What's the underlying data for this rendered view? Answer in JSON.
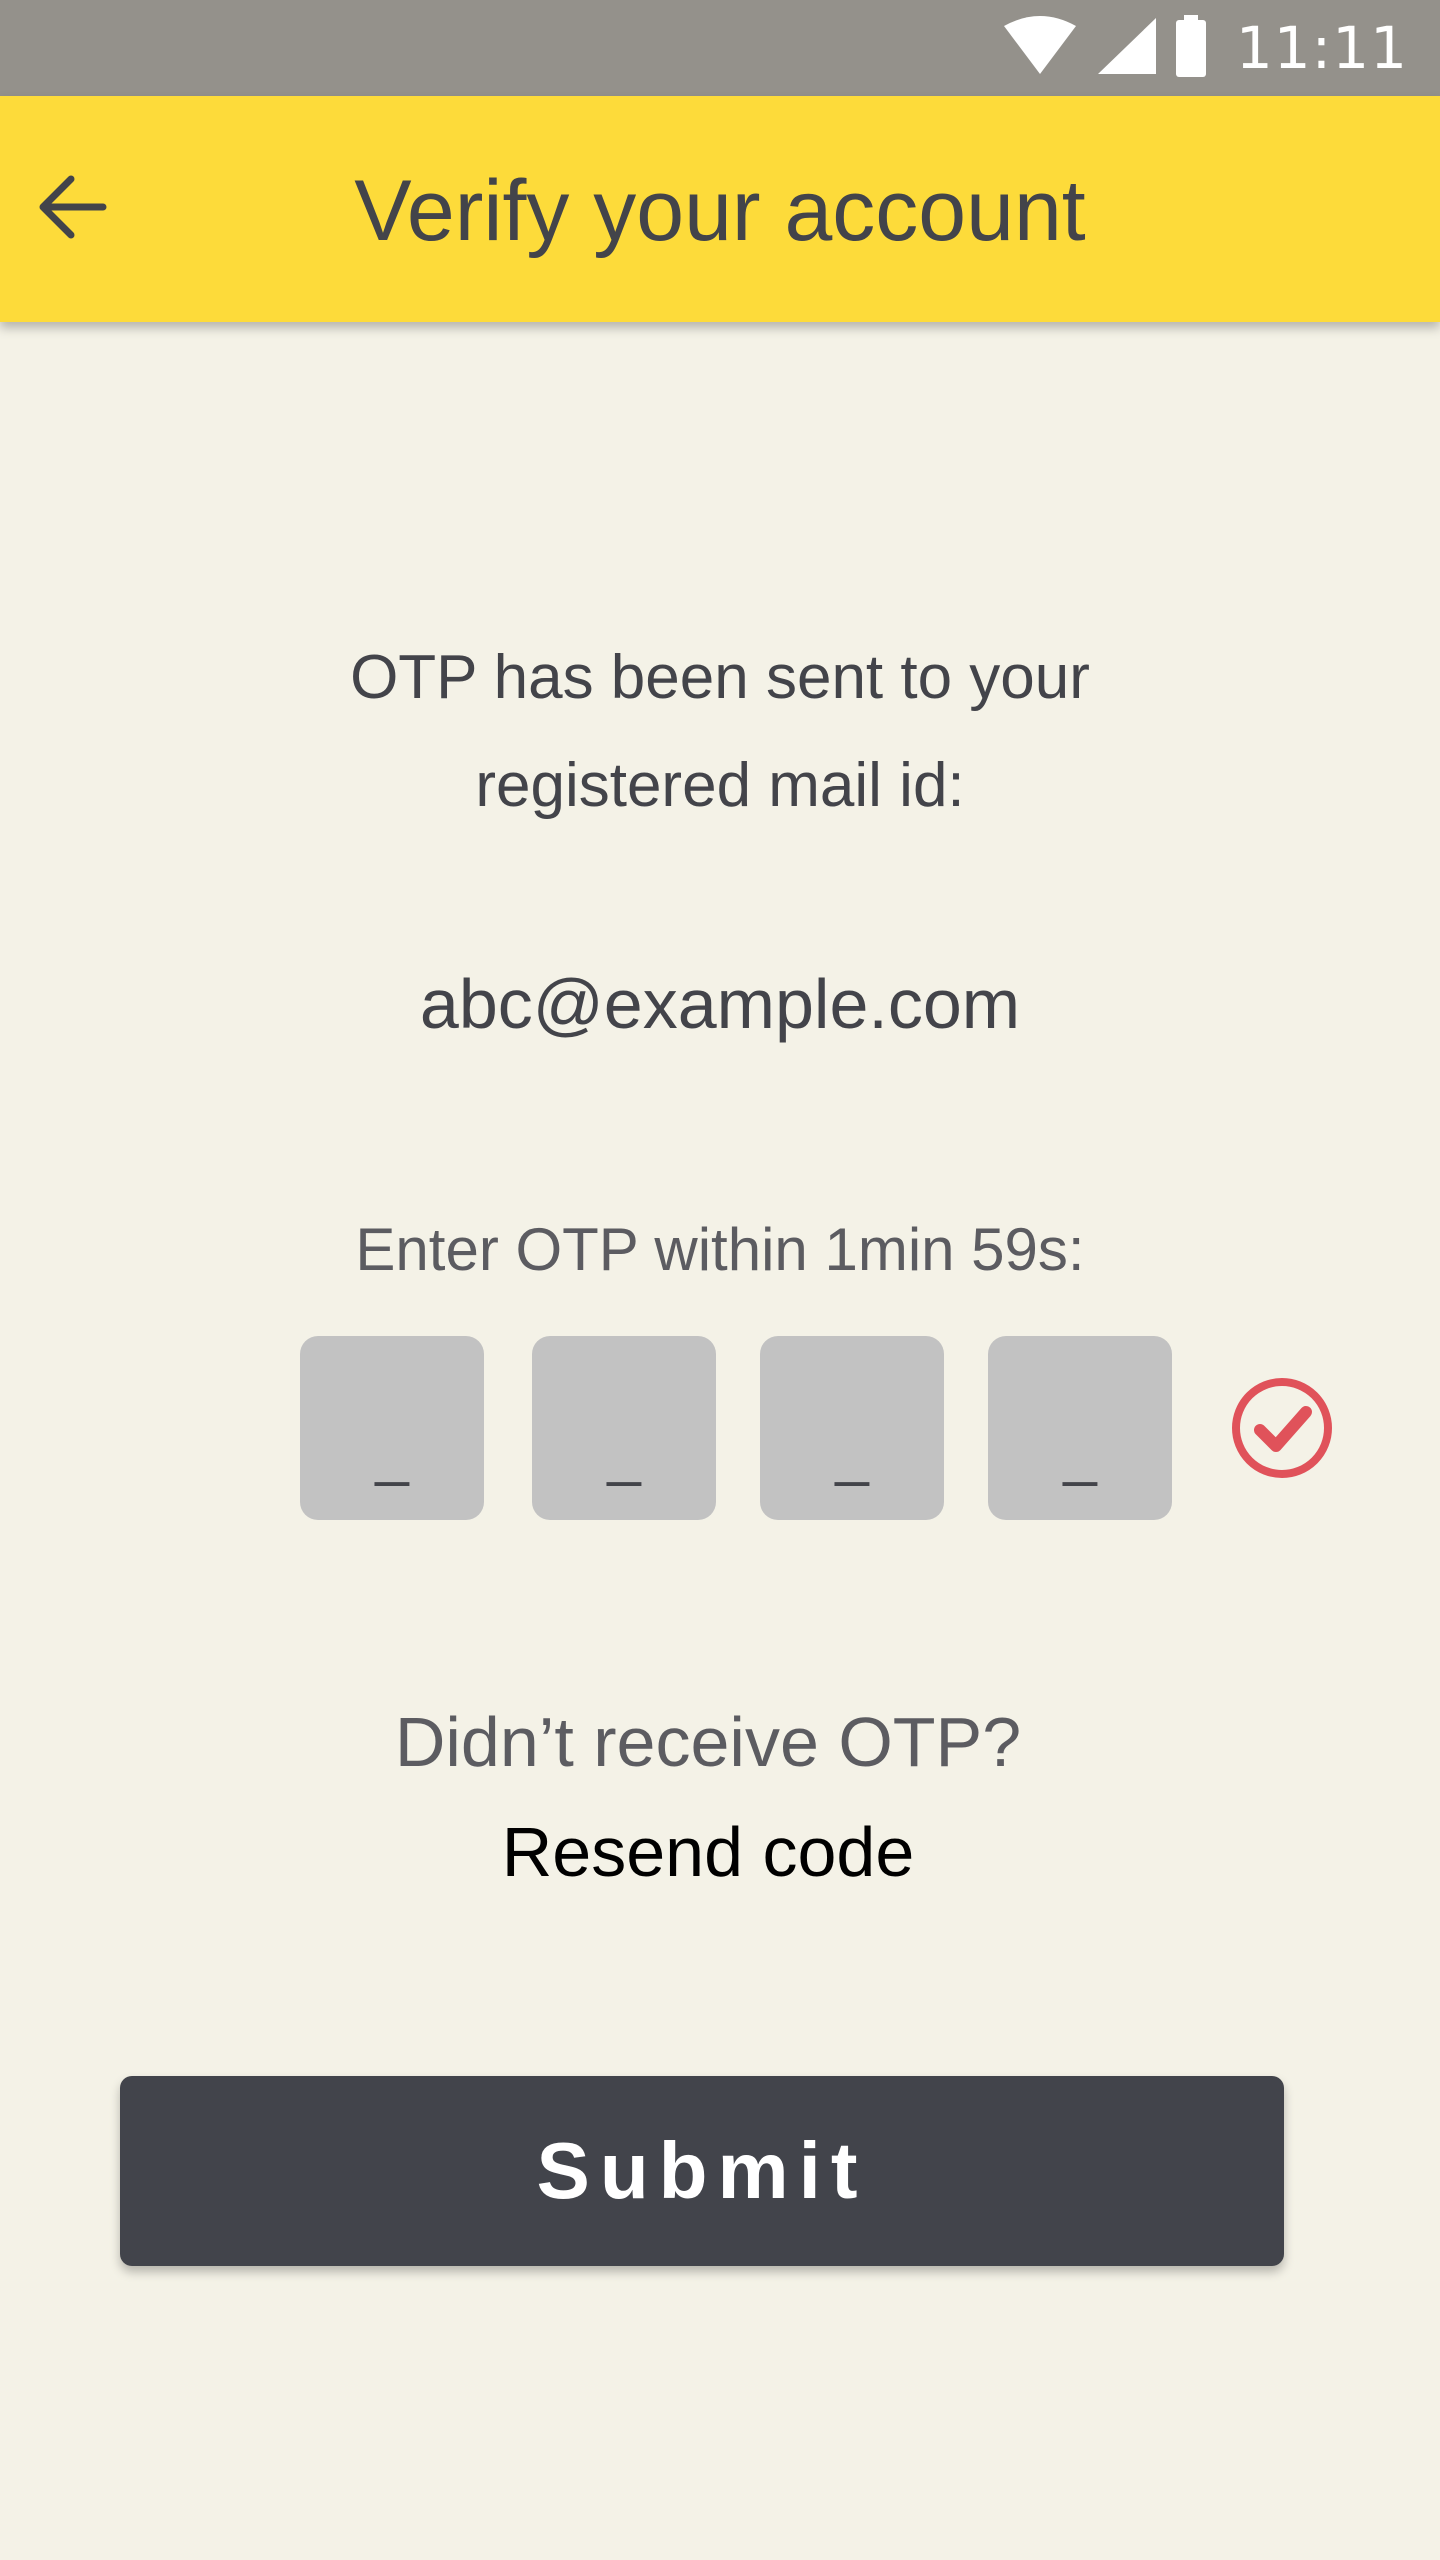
{
  "status_bar": {
    "time": "11:11",
    "icons": [
      "wifi-icon",
      "signal-icon",
      "battery-icon"
    ]
  },
  "app_bar": {
    "title": "Verify your account",
    "back_icon": "arrow-left-icon",
    "background": "#fddb3a"
  },
  "content": {
    "info_line1": "OTP has been sent to your",
    "info_line2": "registered mail id:",
    "email": "abc@example.com",
    "timer_label": "Enter OTP within 1min 59s:",
    "otp_placeholders": [
      "_",
      "_",
      "_",
      "_"
    ],
    "check_icon": "check-circle-icon",
    "check_color": "#e0525a",
    "resend_prompt": "Didn’t receive OTP?",
    "resend_link": "Resend code",
    "submit_label": "Submit"
  },
  "colors": {
    "background": "#f4f2e7",
    "status_bar": "#94918b",
    "button": "#42444b",
    "otp_box": "#c2c2c2"
  }
}
